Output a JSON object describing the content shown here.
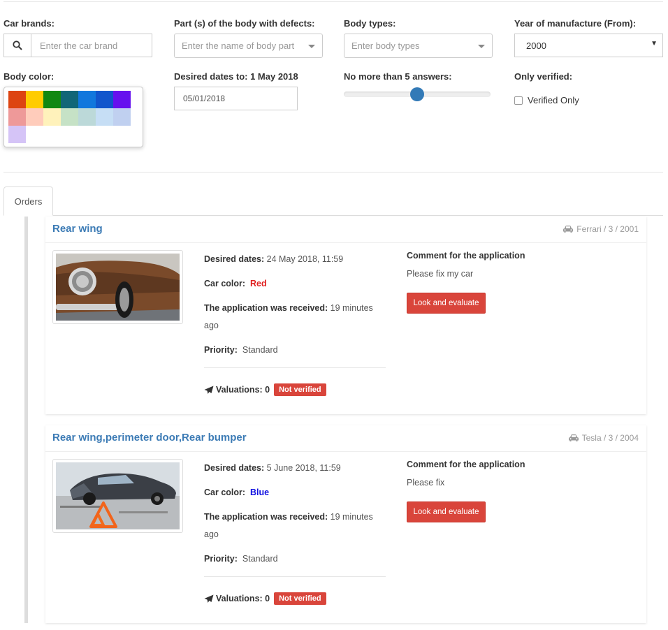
{
  "filters": {
    "car_brands": {
      "label": "Car brands:",
      "placeholder": "Enter the car brand",
      "icon": "search-icon"
    },
    "body_parts": {
      "label": "Part (s) of the body with defects:",
      "placeholder": "Enter the name of body part"
    },
    "body_types": {
      "label": "Body types:",
      "placeholder": "Enter body types"
    },
    "year_from": {
      "label": "Year of manufacture (From):",
      "value": "2000"
    },
    "body_color": {
      "label": "Body color:",
      "swatches": [
        "#dd4411",
        "#ffcc00",
        "#118811",
        "#116677",
        "#1177dd",
        "#1155cc",
        "#6611ee",
        "#ee9999",
        "#ffccbb",
        "#fff2bb",
        "#c6e2c6",
        "#bcd9d9",
        "#c6def5",
        "#c0d0f0",
        "#d5c4f7"
      ]
    },
    "desired_dates": {
      "label": "Desired dates to: 1 May 2018",
      "value": "05/01/2018"
    },
    "answers": {
      "label": "No more than 5 answers:",
      "fraction": 0.5
    },
    "only_verified": {
      "label": "Only verified:",
      "checkbox_label": "Verified Only",
      "checked": false
    }
  },
  "tabs": [
    {
      "label": "Orders",
      "active": true
    }
  ],
  "orders": [
    {
      "title": "Rear wing",
      "meta": "Ferrari / 3 / 2001",
      "desired_dates_label": "Desired dates:",
      "desired_dates": "24 May 2018, 11:59",
      "car_color_label": "Car color:",
      "car_color": "Red",
      "received_label": "The application was received:",
      "received": "19 minutes ago",
      "priority_label": "Priority:",
      "priority": "Standard",
      "valuations_label": "Valuations: 0",
      "status": "Not verified",
      "comment_label": "Comment for the application",
      "comment": "Please fix my car",
      "button": "Look and evaluate"
    },
    {
      "title": "Rear wing,perimeter door,Rear bumper",
      "meta": "Tesla / 3 / 2004",
      "desired_dates_label": "Desired dates:",
      "desired_dates": "5 June 2018, 11:59",
      "car_color_label": "Car color:",
      "car_color": "Blue",
      "received_label": "The application was received:",
      "received": "19 minutes ago",
      "priority_label": "Priority:",
      "priority": "Standard",
      "valuations_label": "Valuations: 0",
      "status": "Not verified",
      "comment_label": "Comment for the application",
      "comment": "Please fix",
      "button": "Look and evaluate"
    }
  ]
}
